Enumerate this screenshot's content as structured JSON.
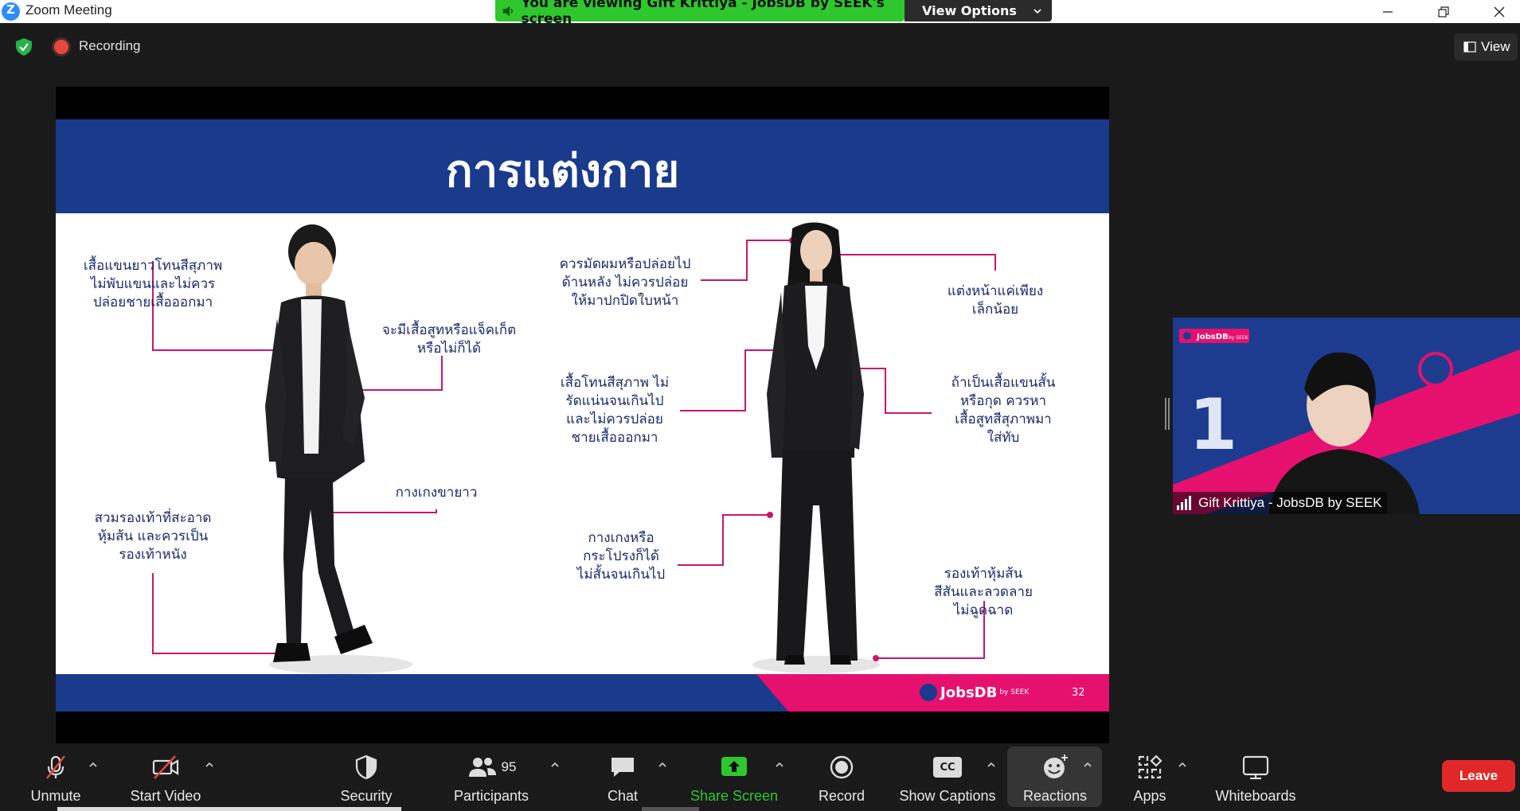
{
  "window": {
    "title": "Zoom Meeting"
  },
  "banner": {
    "text": "You are viewing Gift Krittiya - JobsDB by SEEK's screen",
    "view_options": "View Options",
    "color": "#2ec82e"
  },
  "topbar": {
    "recording": "Recording",
    "view": "View"
  },
  "slide": {
    "title": "การแต่งกาย",
    "page_number": "32",
    "brand": "JobsDB",
    "brand_by": "by SEEK",
    "header_color": "#1a3a8c",
    "accent_color": "#e6106e",
    "male_labels": [
      [
        "เสื้อแขนยาวโทนสีสุภาพ",
        "ไม่พับแขนและไม่ควร",
        "ปล่อยชายเสื้อออกมา"
      ],
      [
        "จะมีเสื้อสูทหรือแจ็คเก็ต",
        "หรือไม่ก็ได้"
      ],
      [
        "กางเกงขายาว"
      ],
      [
        "สวมรองเท้าที่สะอาด",
        "หุ้มส้น และควรเป็น",
        "รองเท้าหนัง"
      ]
    ],
    "female_labels": [
      [
        "ควรมัดผมหรือปล่อยไป",
        "ด้านหลัง ไม่ควรปล่อย",
        "ให้มาปกปิดใบหน้า"
      ],
      [
        "แต่งหน้าแค่เพียง",
        "เล็กน้อย"
      ],
      [
        "เสื้อโทนสีสุภาพ ไม่",
        "รัดแน่นจนเกินไป",
        "และไม่ควรปล่อย",
        "ชายเสื้อออกมา"
      ],
      [
        "ถ้าเป็นเสื้อแขนสั้น",
        "หรือกุด ควรหา",
        "เสื้อสูทสีสุภาพมา",
        "ใส่ทับ"
      ],
      [
        "กางเกงหรือ",
        "กระโปรงก็ได้",
        "ไม่สั้นจนเกินไป"
      ],
      [
        "รองเท้าหุ้มส้น",
        "สีสันและลวดลาย",
        "ไม่ฉูดฉาด"
      ]
    ]
  },
  "participant": {
    "name": "Gift Krittiya - JobsDB by SEEK",
    "video_brand": "JobsDB",
    "video_brand_by": "by SEEK",
    "video_number": "1"
  },
  "toolbar": {
    "unmute": "Unmute",
    "start_video": "Start Video",
    "security": "Security",
    "participants": "Participants",
    "participants_count": "95",
    "chat": "Chat",
    "share_screen": "Share Screen",
    "record": "Record",
    "show_captions": "Show Captions",
    "cc": "CC",
    "reactions": "Reactions",
    "apps": "Apps",
    "whiteboards": "Whiteboards",
    "leave": "Leave"
  }
}
